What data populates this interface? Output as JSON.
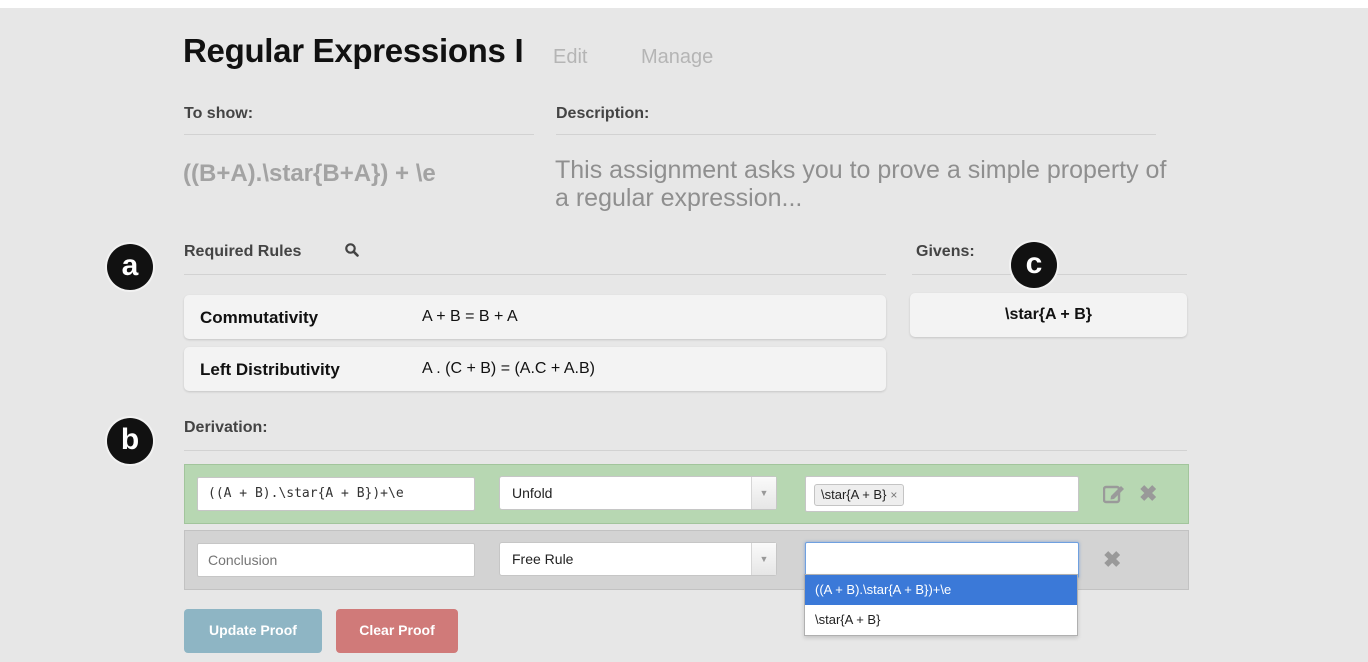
{
  "header": {
    "title": "Regular Expressions I",
    "edit_label": "Edit",
    "manage_label": "Manage"
  },
  "to_show": {
    "label": "To show:",
    "expression": "((B+A).\\star{B+A}) + \\e"
  },
  "description": {
    "label": "Description:",
    "text": "This assignment asks you to prove a simple property of a regular expression..."
  },
  "annotations": {
    "a": "a",
    "b": "b",
    "c": "c"
  },
  "required_rules": {
    "label": "Required Rules",
    "search_icon": "search-icon",
    "rules": [
      {
        "name": "Commutativity",
        "formula": "A + B = B + A"
      },
      {
        "name": "Left Distributivity",
        "formula": "A . (C + B) = (A.C + A.B)"
      }
    ]
  },
  "givens": {
    "label": "Givens:",
    "items": [
      "\\star{A + B}"
    ]
  },
  "derivation": {
    "label": "Derivation:",
    "rows": [
      {
        "expression": "((A + B).\\star{A + B})+\\e",
        "rule": "Unfold",
        "premises": [
          "\\star{A + B}"
        ],
        "tag_remove": "×",
        "edit_icon": "edit-icon",
        "delete_icon": "close-icon",
        "delete_glyph": "✖",
        "status_color": "#b7d7b2"
      },
      {
        "expression_placeholder": "Conclusion",
        "rule": "Free Rule",
        "premise_value": "",
        "delete_icon": "close-icon",
        "delete_glyph": "✖",
        "status_color": "#d3d3d3"
      }
    ],
    "dropdown_options": [
      {
        "label": "((A + B).\\star{A + B})+\\e",
        "highlighted": true
      },
      {
        "label": "\\star{A + B}",
        "highlighted": false
      }
    ]
  },
  "buttons": {
    "update_label": "Update Proof",
    "clear_label": "Clear Proof"
  },
  "colors": {
    "accent_highlight": "#3b79d8",
    "success_row": "#b7d7b2",
    "update_button": "#8eb5c4",
    "clear_button": "#d07a79"
  }
}
